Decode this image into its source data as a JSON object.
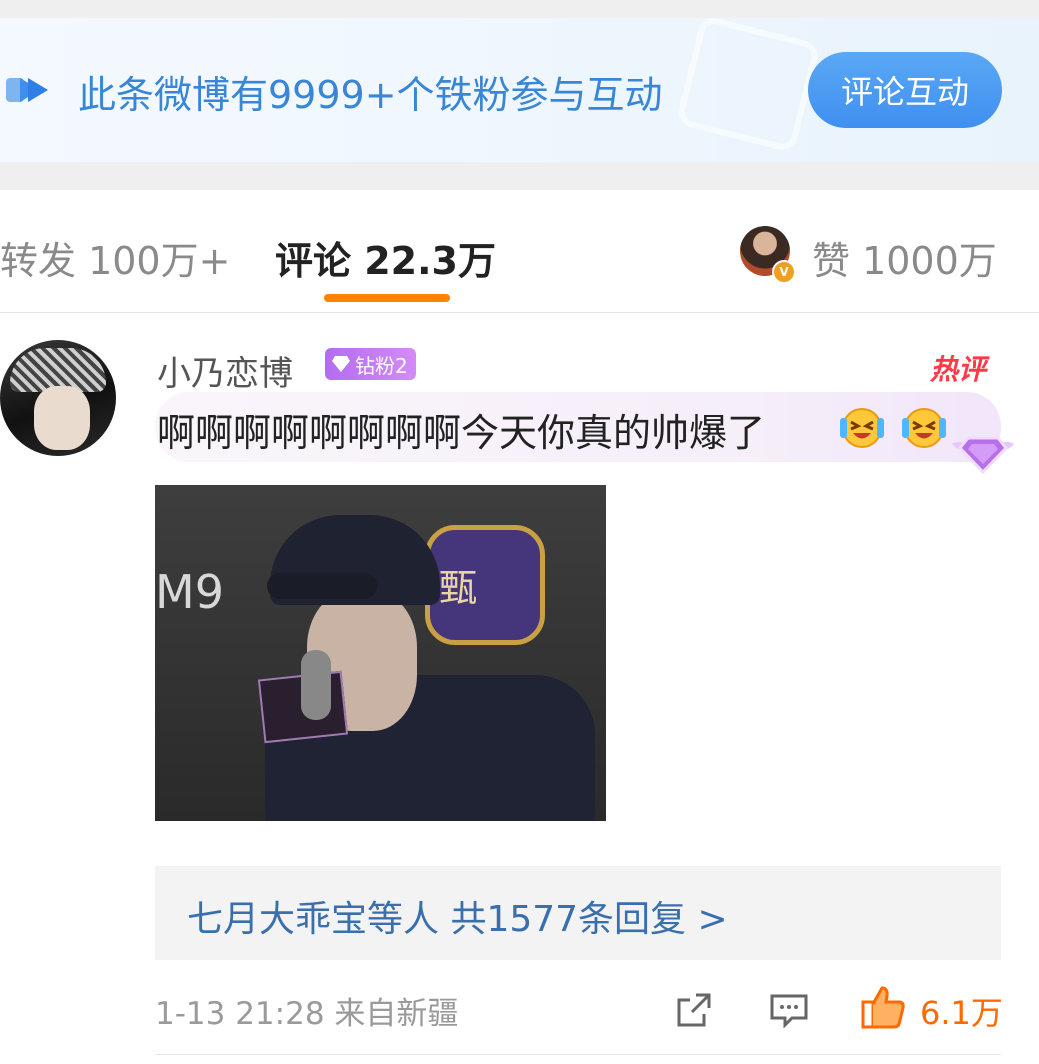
{
  "banner": {
    "text": "此条微博有9999+个铁粉参与互动",
    "button_label": "评论互动"
  },
  "tabs": {
    "repost": "转发 100万+",
    "comment": "评论 22.3万",
    "like": "赞 1000万",
    "active": "comment",
    "accent_color": "#ff8200"
  },
  "comment": {
    "username": "小乃恋博",
    "badge": "钻粉2",
    "hot_label": "热评",
    "text": "啊啊啊啊啊啊啊啊今天你真的帅爆了",
    "emojis": [
      "laughing-crying-emoji",
      "laughing-crying-emoji"
    ],
    "image_overlay_text": "M9",
    "image_logo_text": "甄",
    "replies": "七月大乖宝等人  共1577条回复 >",
    "time_location": "1-13 21:28  来自新疆",
    "like_count": "6.1万"
  },
  "colors": {
    "banner_button": "#3f8ff0",
    "link_blue": "#3a6fae",
    "like_orange": "#ff6a00",
    "hot_red": "#ff3a46"
  }
}
